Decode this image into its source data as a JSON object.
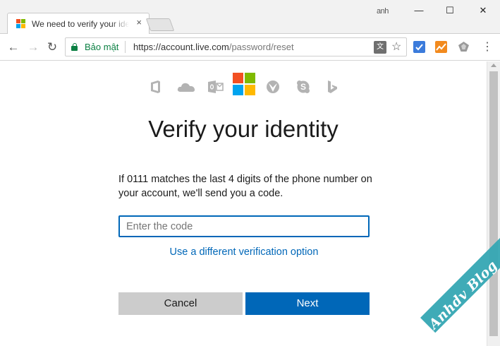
{
  "browser": {
    "tab_title": "We need to verify your identity",
    "tab_close": "×",
    "profile_name": "anh",
    "window_controls": {
      "minimize": "—",
      "maximize": "☐",
      "close": "✕"
    },
    "nav": {
      "back": "←",
      "forward": "→",
      "reload": "↻"
    },
    "secure_label": "Bảo mật",
    "url_domain": "https://account.live.com",
    "url_path": "/password/reset",
    "translate_icon": "文",
    "star_icon": "☆",
    "menu_icon": "⋮",
    "extensions": [
      "blue-checkmark-extension-icon",
      "orange-chart-extension-icon",
      "gray-gem-extension-icon"
    ]
  },
  "page": {
    "app_icons": [
      "office-icon",
      "onedrive-icon",
      "outlook-icon",
      "microsoft-logo",
      "xbox-icon",
      "skype-icon",
      "bing-icon"
    ],
    "heading": "Verify your identity",
    "description": "If 0111 matches the last 4 digits of the phone number on your account, we'll send you a code.",
    "code_input": {
      "placeholder": "Enter the code",
      "value": ""
    },
    "alt_link": "Use a different verification option",
    "cancel_label": "Cancel",
    "next_label": "Next",
    "colors": {
      "accent": "#0067b8",
      "cancel_bg": "#cccccc",
      "secure_green": "#0b8043"
    }
  },
  "watermark": {
    "text": "Anhdv Blog"
  }
}
